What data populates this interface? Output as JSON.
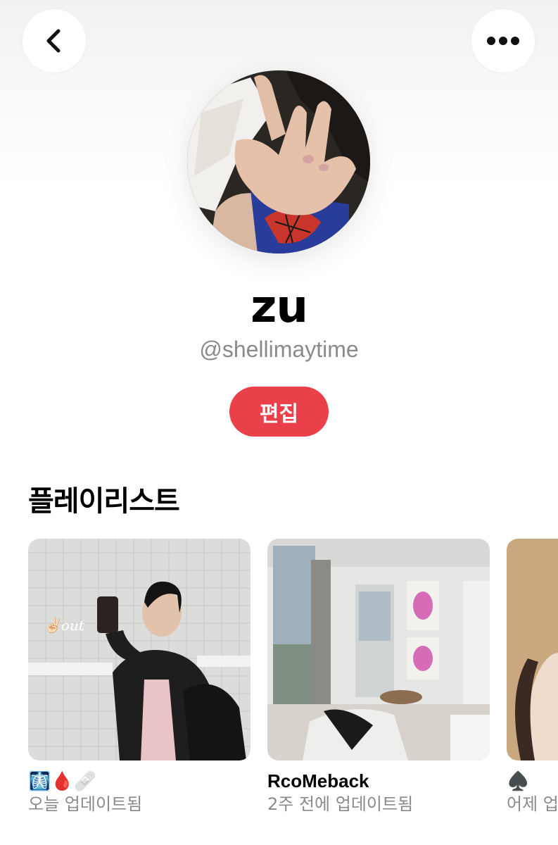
{
  "topbar": {
    "back_icon": "chevron-left-icon",
    "more_icon": "ellipsis-icon"
  },
  "profile": {
    "avatar_alt": "profile photo",
    "display_name": "zu",
    "handle": "@shellimaytime",
    "edit_label": "편집"
  },
  "playlists": {
    "title": "플레이리스트",
    "items": [
      {
        "name": "🩻🩸🩹",
        "updated": "오늘 업데이트됨",
        "cover_text": "✌🏻out"
      },
      {
        "name": "RcoMeback",
        "updated": "2주 전에 업데이트됨"
      },
      {
        "name": "♠️",
        "updated": "어제 업"
      }
    ]
  },
  "colors": {
    "accent": "#e9404a",
    "secondary_text": "#8a8a8a"
  }
}
